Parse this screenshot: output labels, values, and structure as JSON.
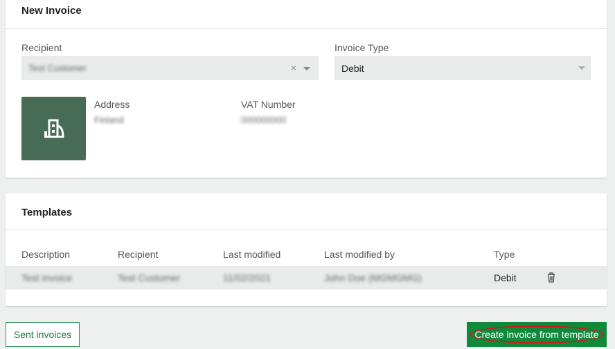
{
  "new_invoice": {
    "title": "New Invoice",
    "recipient_label": "Recipient",
    "recipient_value": "Test Customer",
    "invoice_type_label": "Invoice Type",
    "invoice_type_value": "Debit",
    "address_label": "Address",
    "address_value": "Finland",
    "vat_label": "VAT Number",
    "vat_value": "000000000"
  },
  "templates": {
    "title": "Templates",
    "columns": [
      "Description",
      "Recipient",
      "Last modified",
      "Last modified by",
      "Type"
    ],
    "rows": [
      {
        "description": "Test invoice",
        "recipient": "Test Customer",
        "last_modified": "11/02/2021",
        "last_modified_by": "John Doe (MGMGMG)",
        "type": "Debit"
      }
    ]
  },
  "actions": {
    "sent_invoices": "Sent invoices",
    "create_from_template": "Create invoice from template"
  },
  "colors": {
    "brand": "#0f8a3c",
    "avatar": "#476b55",
    "highlight": "#d11a1a"
  }
}
